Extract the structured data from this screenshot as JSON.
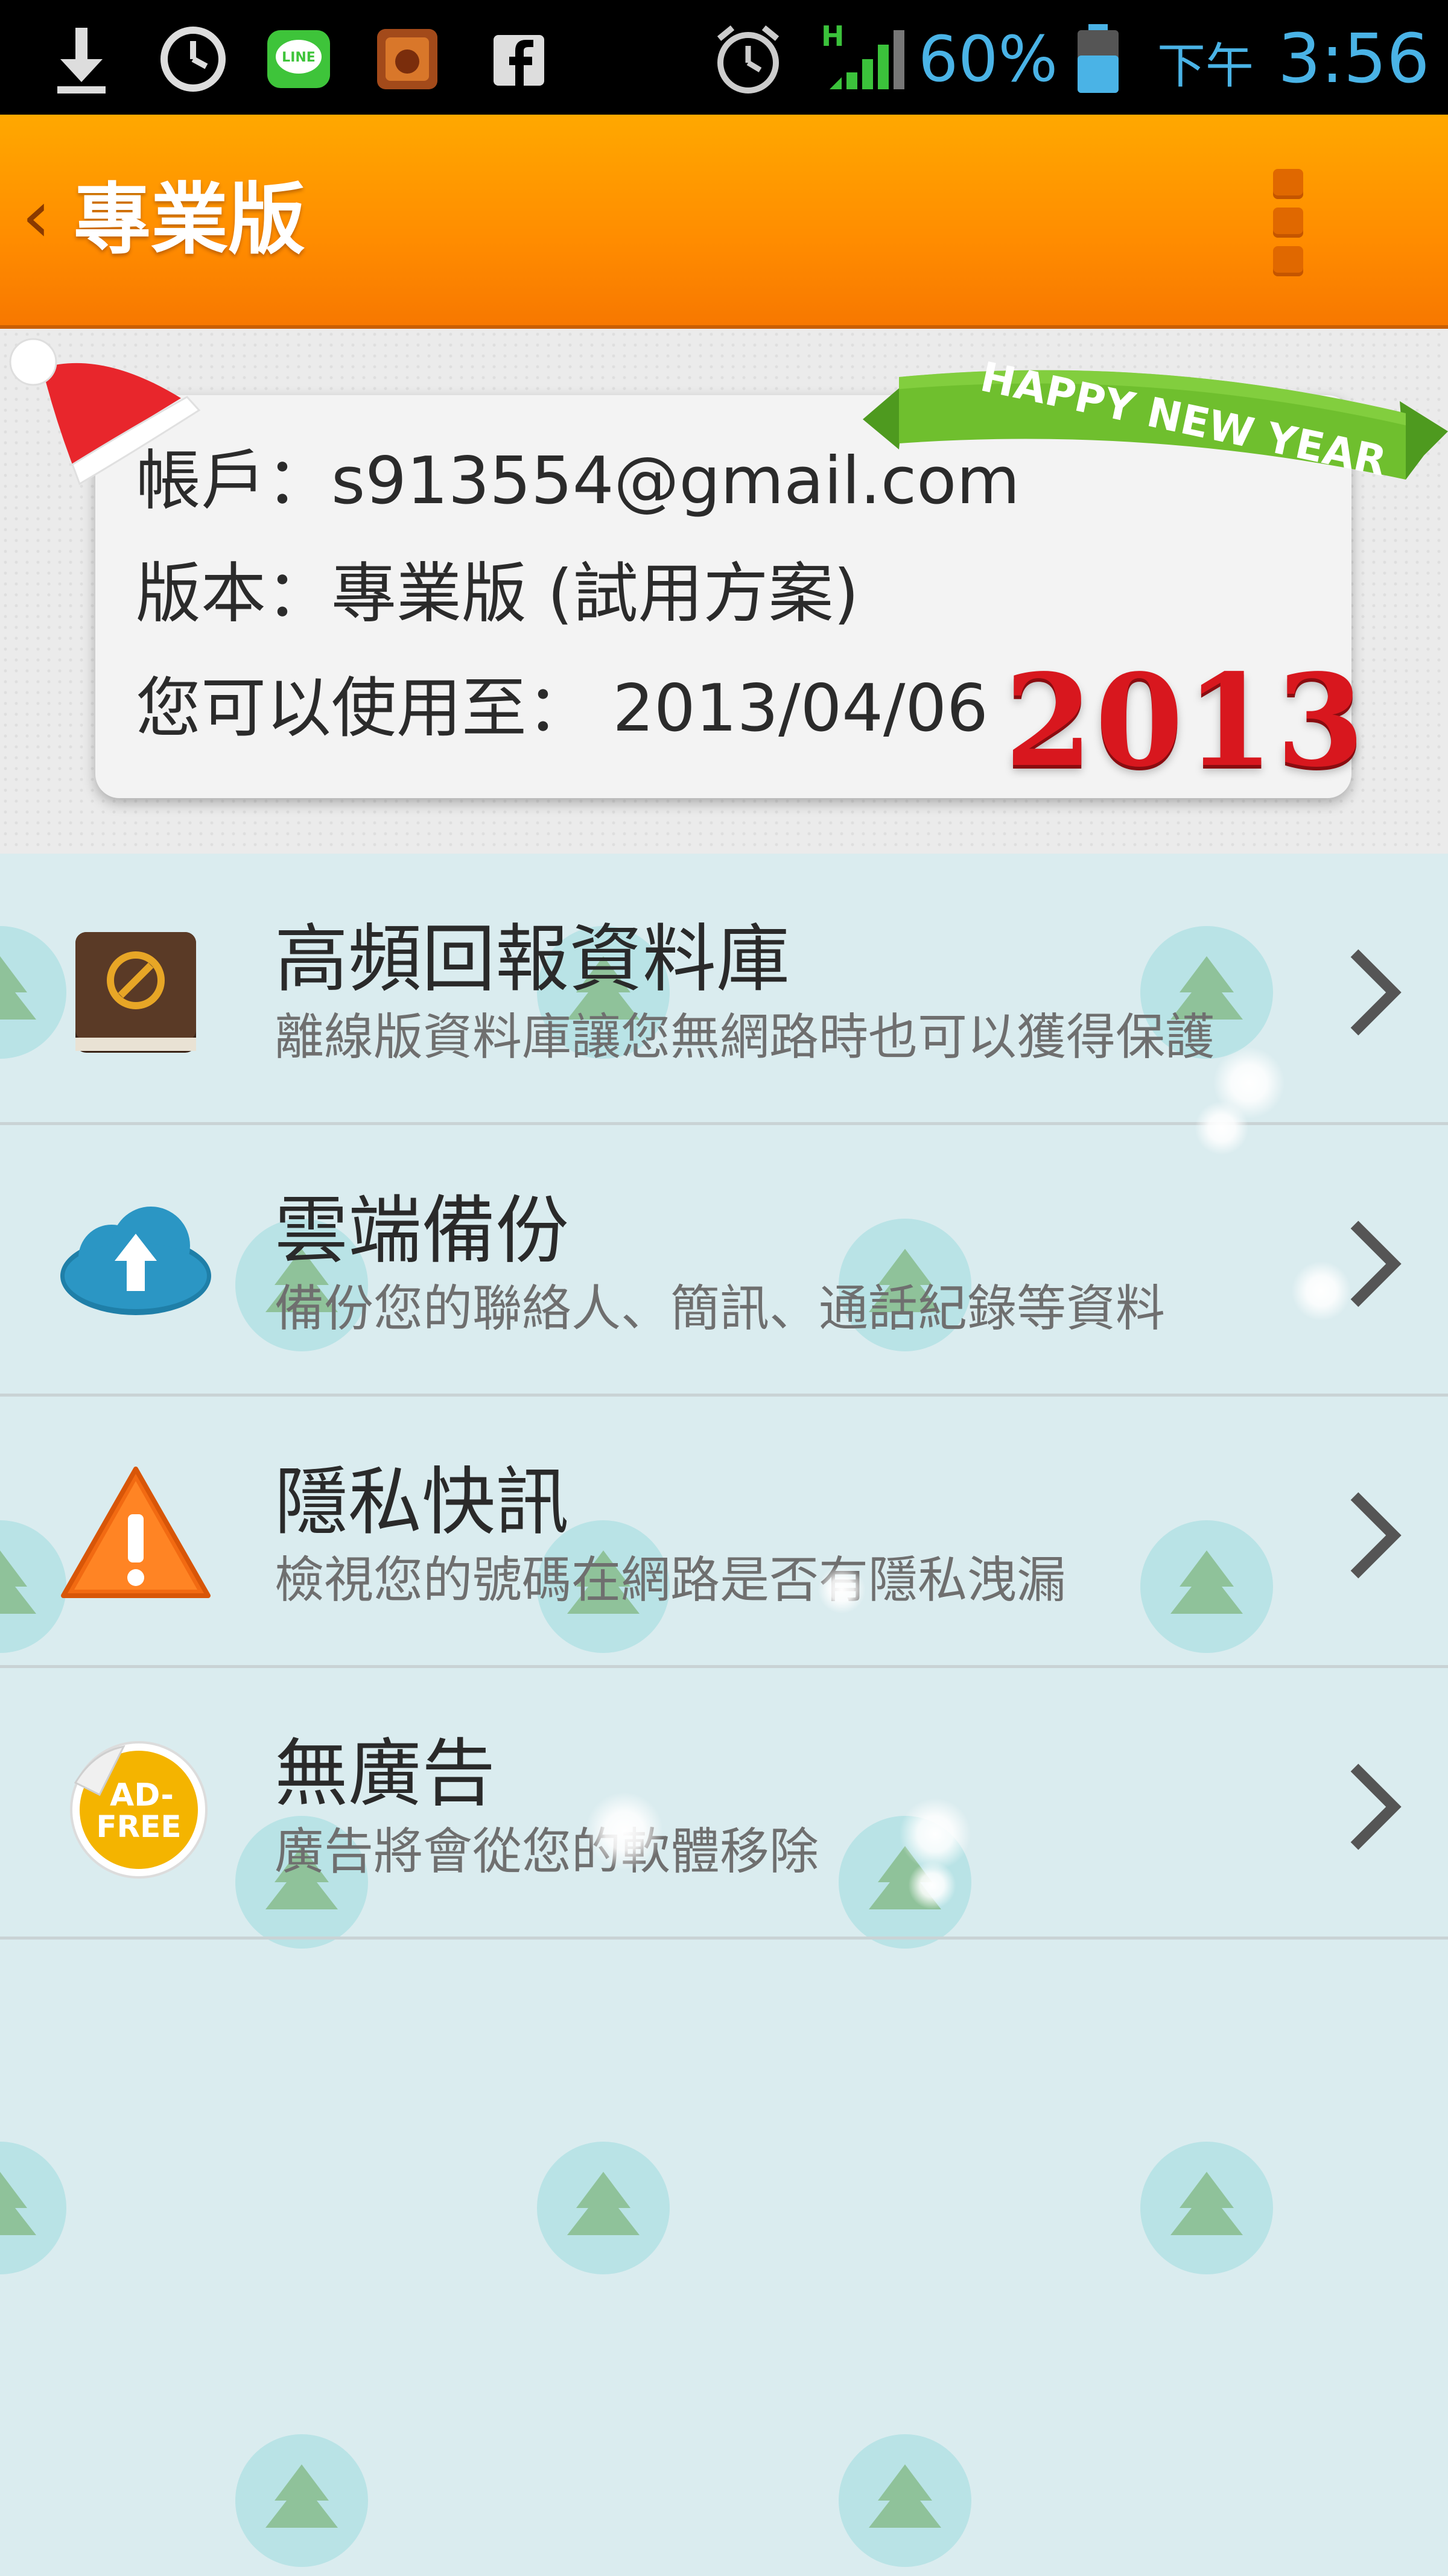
{
  "status_bar": {
    "battery": "60%",
    "time_period": "下午",
    "time": "3:56",
    "network": "H",
    "icons": [
      "download-icon",
      "clock-icon",
      "line-app-icon",
      "app-icon",
      "facebook-icon",
      "alarm-icon",
      "signal-icon",
      "battery-icon"
    ]
  },
  "action_bar": {
    "back_glyph": "‹",
    "title": "專業版",
    "menu_icon": "overflow-menu-icon"
  },
  "account_card": {
    "account_line": "帳戶：s913554@gmail.com",
    "version_line": "版本：專業版 (試用方案)",
    "expiry_line": "您可以使用至： 2013/04/06",
    "ribbon_text": "HAPPY NEW YEAR",
    "year_text": "2013"
  },
  "items": [
    {
      "title": "高頻回報資料庫",
      "subtitle": "離線版資料庫讓您無網路時也可以獲得保護",
      "icon": "database-book-icon"
    },
    {
      "title": "雲端備份",
      "subtitle": "備份您的聯絡人、簡訊、通話紀錄等資料",
      "icon": "cloud-upload-icon"
    },
    {
      "title": "隱私快訊",
      "subtitle": "檢視您的號碼在網路是否有隱私洩漏",
      "icon": "warning-icon"
    },
    {
      "title": "無廣告",
      "subtitle": "廣告將會從您的軟體移除",
      "icon": "ad-free-icon",
      "badge_line1": "AD-",
      "badge_line2": "FREE"
    }
  ],
  "colors": {
    "action_bar": "#ff9400",
    "accent_blue": "#4ab3e6",
    "list_bg": "#daecef",
    "year_red": "#d8171e",
    "ribbon_green": "#6fbf2e"
  }
}
